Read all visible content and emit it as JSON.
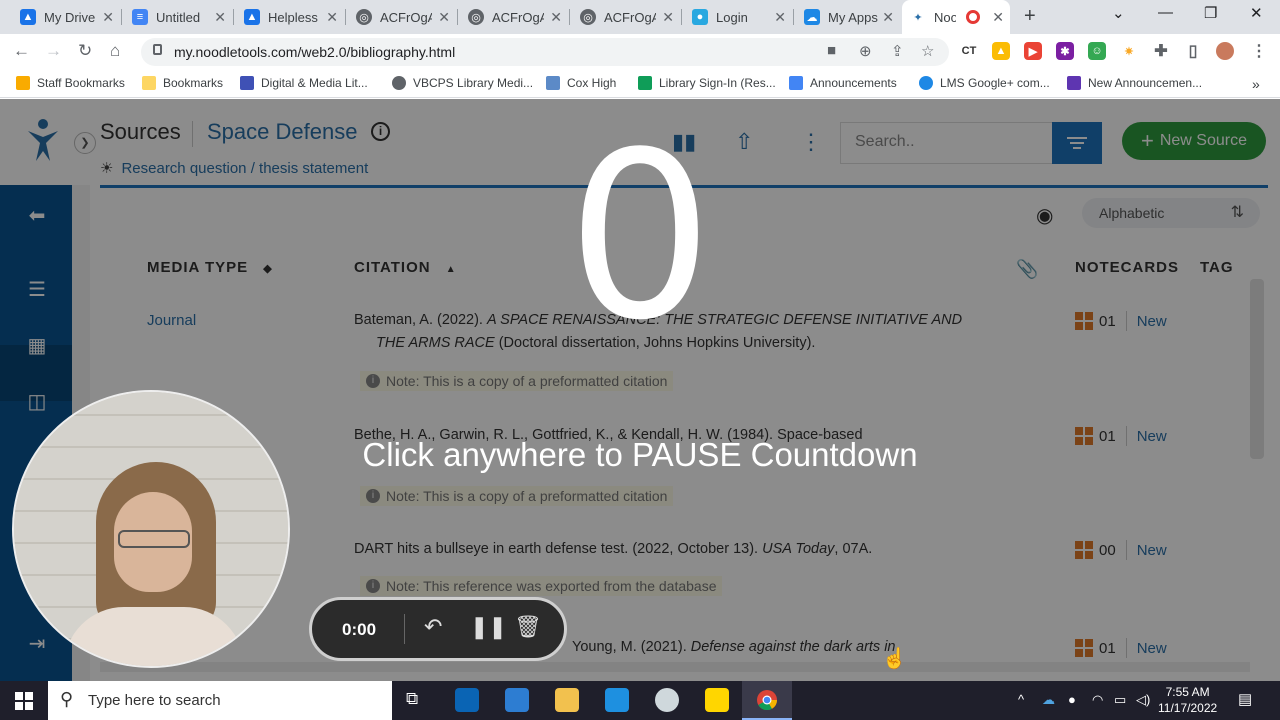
{
  "browser": {
    "tabs": [
      {
        "title": "My Drive",
        "fav_color": "#1a73e8"
      },
      {
        "title": "Untitled",
        "fav_color": "#4285f4"
      },
      {
        "title": "Helpless",
        "fav_color": "#1a73e8"
      },
      {
        "title": "ACFrOgA",
        "fav_color": "#5f6368"
      },
      {
        "title": "ACFrOgA",
        "fav_color": "#5f6368"
      },
      {
        "title": "ACFrOgA",
        "fav_color": "#5f6368"
      },
      {
        "title": "Login",
        "fav_color": "#29a8e0"
      },
      {
        "title": "My Apps",
        "fav_color": "#1e88e5"
      },
      {
        "title": "Noo",
        "fav_color": "#2a6fa8"
      }
    ],
    "url": "my.noodletools.com/web2.0/bibliography.html",
    "bookmarks": [
      "Staff Bookmarks",
      "Bookmarks",
      "Digital & Media Lit...",
      "VBCPS Library Medi...",
      "Cox High",
      "Library Sign-In (Res...",
      "Announcements",
      "LMS Google+ com...",
      "New Announcemen..."
    ]
  },
  "app": {
    "sources_label": "Sources",
    "project_title": "Space Defense",
    "research_question": "Research question / thesis statement",
    "search_placeholder": "Search..",
    "new_source_label": "New Source",
    "sort_label": "Alphabetic",
    "columns": {
      "media": "MEDIA TYPE",
      "citation": "CITATION",
      "notecards": "NOTECARDS",
      "tags": "TAG"
    },
    "rows": [
      {
        "media": "Journal",
        "cite_a": "Bateman, A. (2022). ",
        "cite_b": "A SPACE RENAISSANCE: THE STRATEGIC DEFENSE INITIATIVE AND",
        "cite_c": "THE ARMS RACE",
        "cite_d": " (Doctoral dissertation, Johns Hopkins University).",
        "note": "Note: This is a copy of a preformatted citation",
        "count": "01",
        "new": "New"
      },
      {
        "media": "",
        "cite_a": "Bethe, H. A., Garwin, R. L., Gottfried, K., & Kendall, H. W. (1984). Space-based",
        "note": "Note: This is a copy of a preformatted citation",
        "count": "01",
        "new": "New"
      },
      {
        "media": "",
        "cite_a": "DART hits a bullseye in earth defense test. (2022, October 13). ",
        "cite_b": "USA Today",
        "cite_c": ", 07A.",
        "note": "Note: This reference was exported from the database",
        "count": "00",
        "new": "New"
      },
      {
        "media": "",
        "cite_a": "Young, M. (2021). ",
        "cite_b": "Defense against the dark arts in",
        "count": "01",
        "new": "New"
      }
    ]
  },
  "overlay": {
    "countdown": "0",
    "message": "Click anywhere to PAUSE Countdown",
    "timer": "0:00"
  },
  "taskbar": {
    "search_placeholder": "Type here to search",
    "time": "7:55 AM",
    "date": "11/17/2022"
  }
}
